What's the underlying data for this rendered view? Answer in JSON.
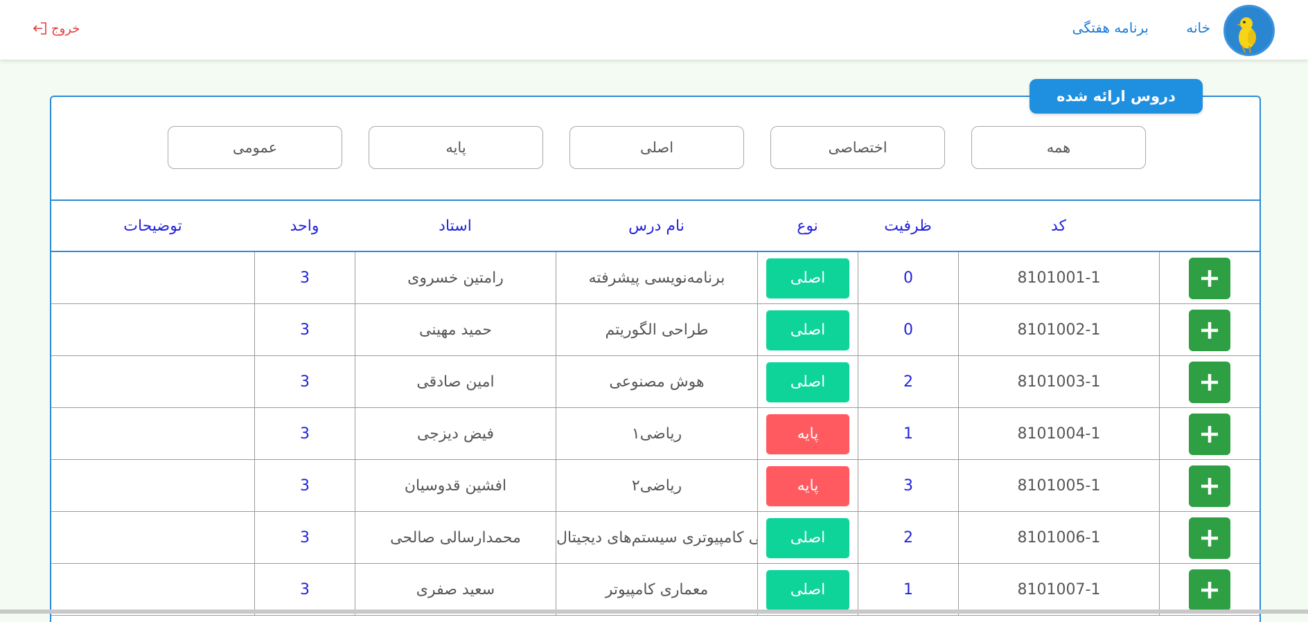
{
  "nav": {
    "home": "خانه",
    "weekly_program": "برنامه هفتگی",
    "logout": "خروج"
  },
  "panel": {
    "title": "دروس ارائه شده"
  },
  "filters": [
    "همه",
    "اختصاصی",
    "اصلی",
    "پایه",
    "عمومی"
  ],
  "table": {
    "headers": {
      "code": "کد",
      "capacity": "ظرفیت",
      "type": "نوع",
      "name": "نام درس",
      "professor": "استاد",
      "units": "واحد",
      "description": "توضیحات"
    },
    "rows": [
      {
        "code": "8101001-1",
        "capacity": "0",
        "type": "اصلی",
        "name": "برنامه‌نویسی پیشرفته",
        "professor": "رامتین خسروی",
        "units": "3",
        "description": ""
      },
      {
        "code": "8101002-1",
        "capacity": "0",
        "type": "اصلی",
        "name": "طراحی الگوریتم",
        "professor": "حمید مهینی",
        "units": "3",
        "description": ""
      },
      {
        "code": "8101003-1",
        "capacity": "2",
        "type": "اصلی",
        "name": "هوش مصنوعی",
        "professor": "امین صادقی",
        "units": "3",
        "description": ""
      },
      {
        "code": "8101004-1",
        "capacity": "1",
        "type": "پایه",
        "name": "ریاضی۱",
        "professor": "فیض دیزجی",
        "units": "3",
        "description": ""
      },
      {
        "code": "8101005-1",
        "capacity": "3",
        "type": "پایه",
        "name": "ریاضی۲",
        "professor": "افشین قدوسیان",
        "units": "3",
        "description": ""
      },
      {
        "code": "8101006-1",
        "capacity": "2",
        "type": "اصلی",
        "name": "طراحی کامپیوتری سیستم‌های دیجیتال",
        "professor": "محمدارسالی صالحی",
        "units": "3",
        "description": ""
      },
      {
        "code": "8101007-1",
        "capacity": "1",
        "type": "اصلی",
        "name": "معماری کامپیوتر",
        "professor": "سعید صفری",
        "units": "3",
        "description": ""
      }
    ]
  },
  "colors": {
    "add_button": "#2ea043",
    "badge_main": "#0fd49a",
    "badge_base": "#ff5a5f",
    "primary": "#1f8fe0"
  }
}
